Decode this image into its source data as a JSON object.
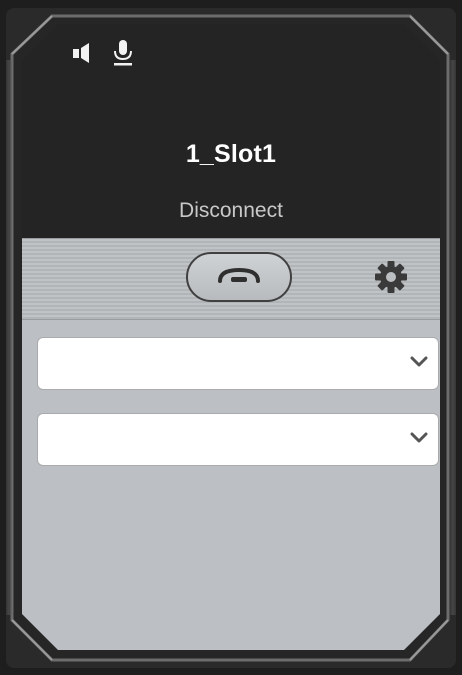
{
  "slot": {
    "name": "1_Slot1",
    "status": "Disconnect"
  },
  "top_icons": [
    "speaker-icon",
    "microphone-icon"
  ],
  "controls": {
    "hangup_icon": "phone-hangup-icon",
    "settings_icon": "gear-icon"
  },
  "selects": [
    {
      "value": "",
      "icon": "chevron-down-icon"
    },
    {
      "value": "",
      "icon": "chevron-down-icon"
    }
  ],
  "colors": {
    "header_background": "#252525",
    "panel_background": "#bcc0c4",
    "frame_border": "#6a6a6a",
    "name_text": "#ffffff",
    "status_text": "#c8c8c8"
  }
}
